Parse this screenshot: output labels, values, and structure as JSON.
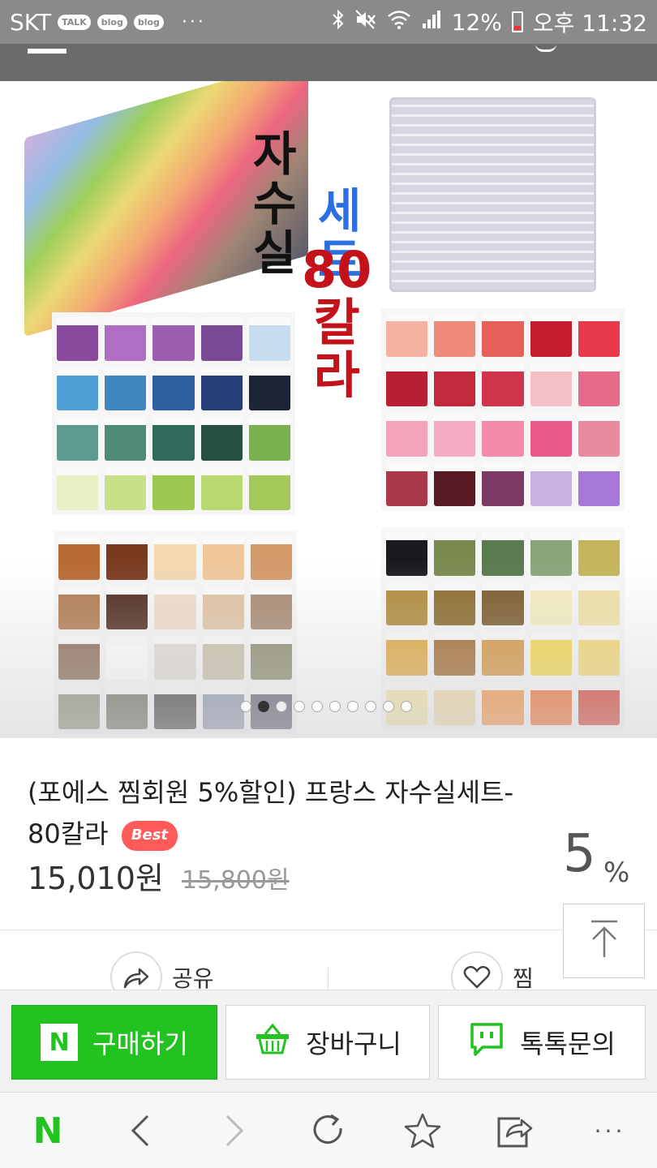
{
  "status_bar": {
    "carrier": "SKT",
    "talk_badge": "TALK",
    "blog_badge_1": "blog",
    "blog_badge_2": "blog",
    "more": "···",
    "battery": "12%",
    "time": "오후 11:32"
  },
  "product_image": {
    "headline_line1": "자수실",
    "headline_line2": "세트",
    "headline_line3": "80칼라",
    "slide_count": 10,
    "active_slide": 2,
    "colors": {
      "panel1": [
        "#8a4a9c",
        "#b06dc4",
        "#9c5fb0",
        "#7a4a94",
        "#c8dcf0",
        "#4f9fd6",
        "#3f86c0",
        "#2f5f9c",
        "#253e78",
        "#1e2438",
        "#5f9a8e",
        "#4f8a78",
        "#2f6a5a",
        "#274f42",
        "#7ab04f",
        "#e8f0c4",
        "#c8e08a",
        "#9cc84f",
        "#b8d870",
        "#a4c85a"
      ],
      "panel2": [
        "#f4b0a0",
        "#f08a7a",
        "#e8605a",
        "#c41e2e",
        "#e83a4a",
        "#b81e34",
        "#c4283c",
        "#d0344c",
        "#f4c0c8",
        "#e86a8a",
        "#f4a4b8",
        "#f4aac0",
        "#f48aa8",
        "#e85a88",
        "#e88aa0",
        "#a83a4a",
        "#5a1a24",
        "#7a3a64",
        "#c8b0e0",
        "#a478d4"
      ],
      "panel3": [
        "#b86a34",
        "#7a3a20",
        "#f4d8b0",
        "#f0c89c",
        "#d49a6a",
        "#b07a4f",
        "#4f2a1e",
        "#f0dcc8",
        "#e0c4a4",
        "#a88a72",
        "#8a6a54",
        "#ffffff",
        "#e0dcd4",
        "#c8c0a8",
        "#8a8a6a",
        "#8a8a74",
        "#6a6a5a",
        "#3e3e3e",
        "#8a94a8",
        "#5a5a6a"
      ],
      "panel4": [
        "#1a1a1e",
        "#7a8a4f",
        "#5a7a4f",
        "#8aa47a",
        "#c4b45a",
        "#b08a3a",
        "#8a6a2a",
        "#7a5a2a",
        "#f4ecc0",
        "#f0e0a4",
        "#e0a83e",
        "#a0682a",
        "#d4943e",
        "#f4d84a",
        "#f4d870",
        "#f4e4a4",
        "#f0d8a4",
        "#f4903e",
        "#f06a2a",
        "#d43a2a"
      ]
    }
  },
  "product": {
    "title_prefix": "(포에스 찜회원 5%할인) 프랑스 자수실세트- 80칼라",
    "badge": "Best",
    "price": "15,010원",
    "original_price": "15,800원",
    "discount_number": "5",
    "discount_unit": "%"
  },
  "social": {
    "share_label": "공유",
    "like_label": "찜"
  },
  "actions": {
    "buy_label": "구매하기",
    "buy_icon_letter": "N",
    "cart_label": "장바구니",
    "talk_label": "톡톡문의"
  },
  "browser": {
    "home_letter": "N",
    "more": "···"
  },
  "theme": {
    "naver_green": "#22c220",
    "badge_red": "#ff5a5a",
    "headline_blue": "#2c6fe0",
    "headline_red": "#c4121b"
  }
}
